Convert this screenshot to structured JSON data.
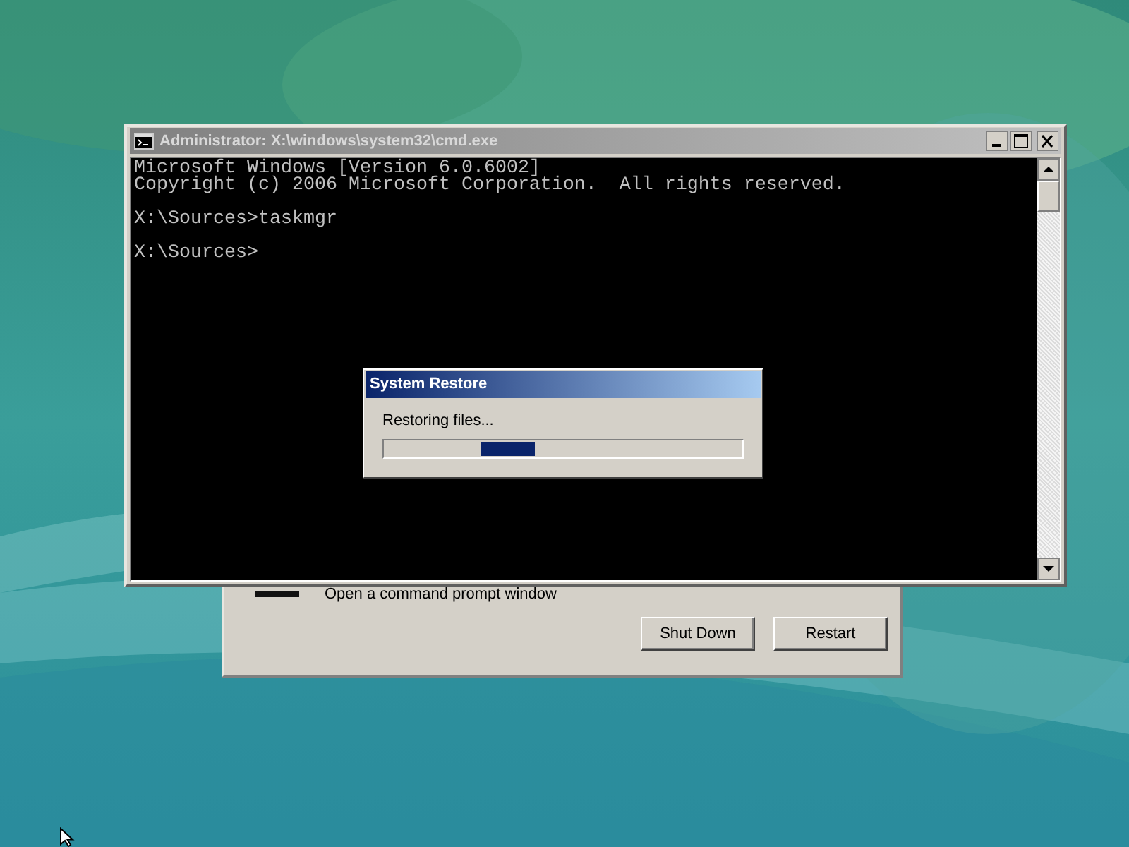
{
  "recovery_dialog": {
    "option_description": "Open a command prompt window",
    "buttons": [
      "Shut Down",
      "Restart"
    ]
  },
  "console_window": {
    "title": "Administrator: X:\\windows\\system32\\cmd.exe",
    "active": false,
    "blocks": [
      [
        "Microsoft Windows [Version 6.0.6002]",
        "Copyright (c) 2006 Microsoft Corporation.  All rights reserved."
      ],
      [
        "X:\\Sources>taskmgr"
      ],
      [
        "X:\\Sources>"
      ]
    ]
  },
  "progress_dialog": {
    "title": "System Restore",
    "message": "Restoring files...",
    "indeterminate": true
  }
}
